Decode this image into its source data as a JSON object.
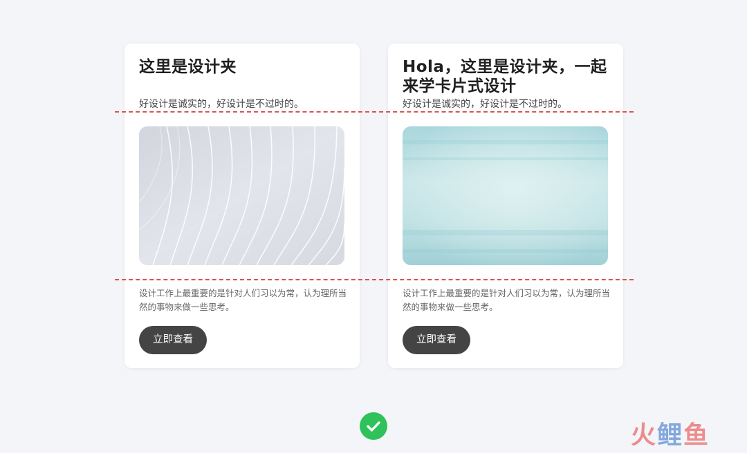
{
  "cards": [
    {
      "title": "这里是设计夹",
      "subtitle": "好设计是诚实的，好设计是不过时的。",
      "image": "abstract-white-waves",
      "body": "设计工作上最重要的是针对人们习以为常，认为理所当然的事物来做一些思考。",
      "button_label": "立即查看"
    },
    {
      "title": "Hola，这里是设计夹，一起来学卡片式设计",
      "subtitle": "好设计是诚实的，好设计是不过时的。",
      "image": "teal-watercolor",
      "body": "设计工作上最重要的是针对人们习以为常，认为理所当然的事物来做一些思考。",
      "button_label": "立即查看"
    }
  ],
  "status": {
    "icon": "check-circle-icon",
    "color": "#2fc25b"
  },
  "guide_line_color": "#d9534f",
  "watermark": {
    "part1": "火",
    "part2": "鲤",
    "part3": "鱼"
  }
}
